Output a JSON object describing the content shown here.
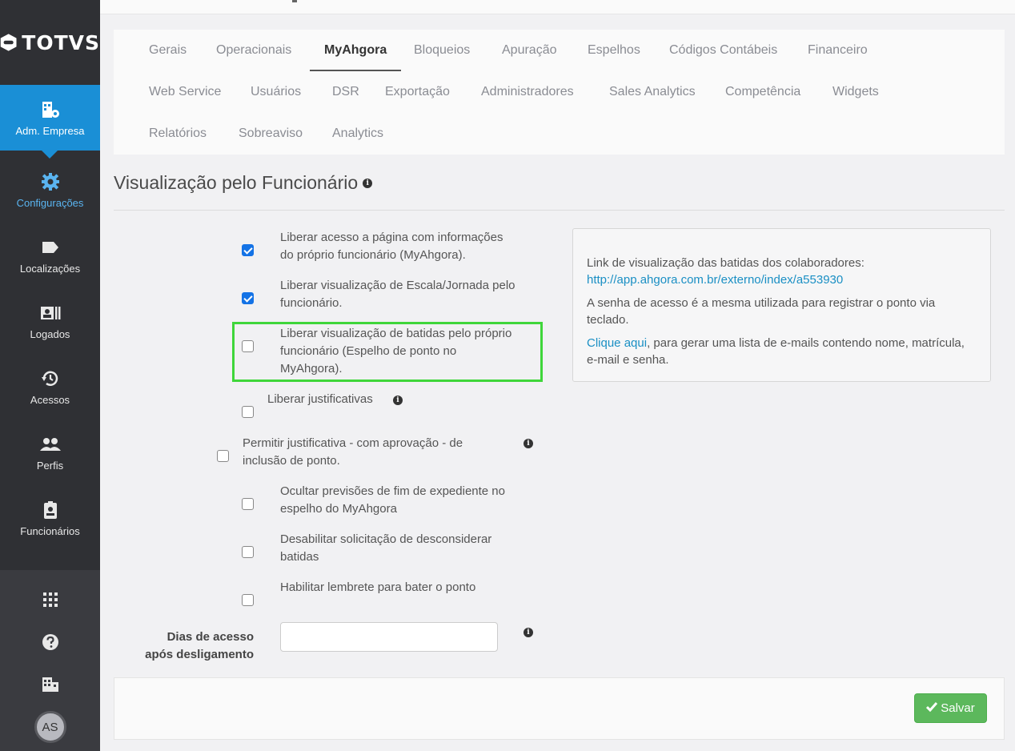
{
  "sidebar": {
    "logo_text": "TOTVS",
    "items": [
      {
        "label": "Adm. Empresa",
        "icon": "building-gear-icon"
      },
      {
        "label": "Configurações",
        "icon": "gear-icon"
      },
      {
        "label": "Localizações",
        "icon": "tag-icon"
      },
      {
        "label": "Logados",
        "icon": "id-card-icon"
      },
      {
        "label": "Acessos",
        "icon": "history-icon"
      },
      {
        "label": "Perfis",
        "icon": "users-icon"
      },
      {
        "label": "Funcionários",
        "icon": "badge-icon"
      }
    ],
    "bottom": {
      "apps_icon": "grid-icon",
      "help_icon": "question-icon",
      "company_icon": "building-icon",
      "avatar_initials": "AS"
    }
  },
  "tabs": {
    "row1": [
      "Gerais",
      "Operacionais",
      "MyAhgora",
      "Bloqueios",
      "Apuração",
      "Espelhos",
      "Códigos Contábeis",
      "Financeiro"
    ],
    "row2": [
      "Web Service",
      "Usuários",
      "DSR",
      "Exportação",
      "Administradores",
      "Sales Analytics",
      "Competência",
      "Widgets"
    ],
    "row3": [
      "Relatórios",
      "Sobreaviso",
      "Analytics"
    ],
    "active": "MyAhgora"
  },
  "section": {
    "title": "Visualização pelo Funcionário"
  },
  "options": [
    {
      "label_lines": [
        "Liberar acesso a página com informações",
        "do próprio funcionário (MyAhgora)."
      ],
      "checked": true
    },
    {
      "label_lines": [
        "Liberar visualização de Escala/Jornada pelo",
        "funcionário."
      ],
      "checked": true
    },
    {
      "label_lines": [
        "Liberar visualização de batidas pelo próprio",
        "funcionário (Espelho de ponto no",
        "MyAhgora)."
      ],
      "checked": false
    },
    {
      "label_lines": [
        "Liberar justificativas"
      ],
      "checked": false
    },
    {
      "label_lines": [
        "Permitir justificativa - com aprovação - de",
        "inclusão de ponto."
      ],
      "checked": false
    },
    {
      "label_lines": [
        "Ocultar previsões de fim de expediente no",
        "espelho do MyAhgora"
      ],
      "checked": false
    },
    {
      "label_lines": [
        "Desabilitar solicitação de desconsiderar",
        "batidas"
      ],
      "checked": false
    },
    {
      "label_lines": [
        "Habilitar lembrete para bater o ponto"
      ],
      "checked": false
    }
  ],
  "info_box": {
    "line1": "Link de visualização das batidas dos colaboradores:",
    "link_url": "http://app.ahgora.com.br/externo/index/a553930",
    "line2": "A senha de acesso é a mesma utilizada para registrar o ponto via teclado.",
    "click_link": "Clique aqui",
    "line3_rest": ", para gerar uma lista de e-mails contendo nome, matrícula, e-mail e senha."
  },
  "dias_field": {
    "label_line1": "Dias de acesso",
    "label_line2": "após desligamento",
    "value": ""
  },
  "footer": {
    "save_label": "Salvar"
  },
  "colors": {
    "sidebar_bg": "#2f3034",
    "active_nav": "#1a8fd6",
    "highlight": "#3fd63a",
    "save_green": "#5cb85c",
    "link": "#1a8fc4"
  }
}
